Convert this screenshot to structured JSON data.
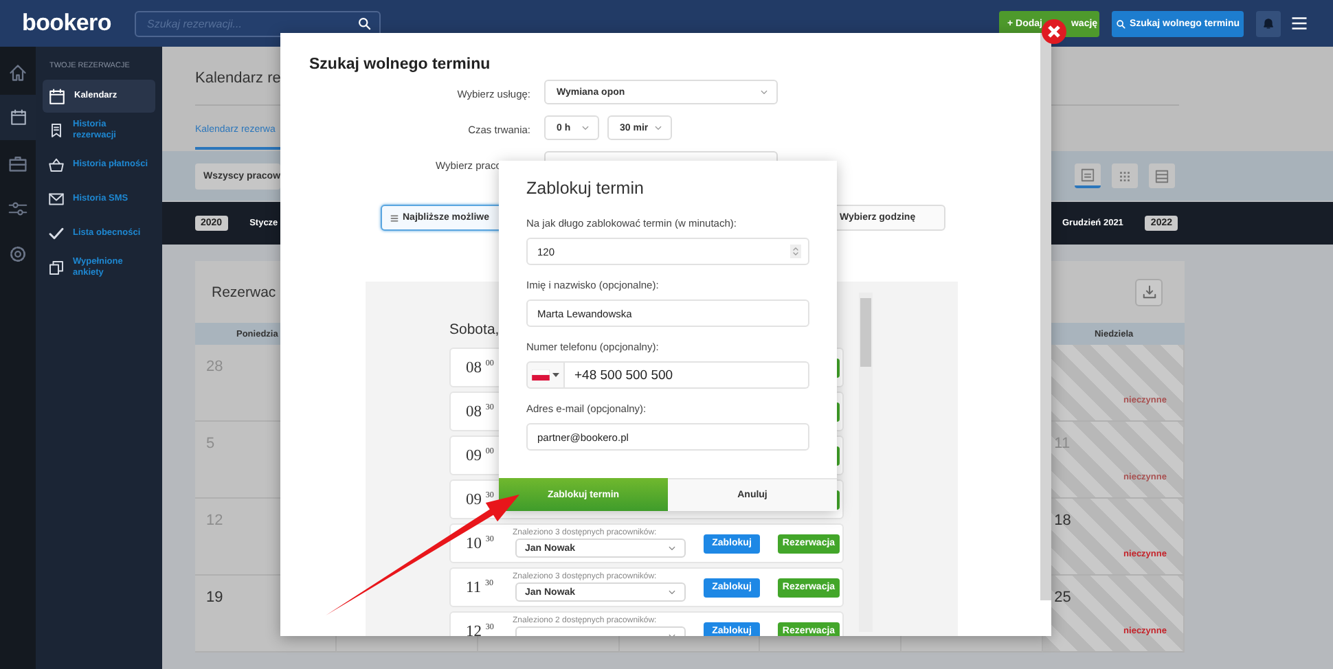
{
  "topbar": {
    "logo": "bookero",
    "search": {
      "placeholder": "Szukaj rezerwacji..."
    },
    "buttons": [
      {
        "label_parts": [
          "+ Dodaj",
          "wację"
        ],
        "kind": "add"
      },
      {
        "label": "Szukaj wolnego terminu",
        "kind": "search"
      }
    ]
  },
  "rail": [
    {
      "selected": false
    },
    {
      "selected": true
    },
    {
      "selected": false
    },
    {
      "selected": false
    },
    {
      "selected": false
    }
  ],
  "sidebar": {
    "heading": "TWOJE REZERWACJE",
    "items": [
      {
        "label": "Kalendarz",
        "selected": true
      },
      {
        "label": "Historia rezerwacji",
        "selected": false
      },
      {
        "label": "Historia płatności",
        "selected": false
      },
      {
        "label": "Historia SMS",
        "selected": false
      },
      {
        "label": "Lista obecności",
        "selected": false
      },
      {
        "label": "Wypełnione ankiety",
        "selected": false
      }
    ]
  },
  "main": {
    "title": "Kalendarz re",
    "tab": "Kalendarz rezerwa",
    "filter": "Wszyscy pracow",
    "views": [
      {
        "selected": true
      },
      {
        "selected": false
      },
      {
        "selected": false
      }
    ],
    "months": [
      {
        "label": "2020",
        "kind": "year"
      },
      {
        "label": "Stycze",
        "kind": "month"
      },
      {
        "label": "Grudzień 2021",
        "kind": "month"
      },
      {
        "label": "2022",
        "kind": "year"
      }
    ],
    "calendar": {
      "title": "Rezerwac",
      "columns": [
        "Poniedzia",
        "Niedziela"
      ],
      "rows": [
        {
          "monday": {
            "day": "28",
            "past": true
          },
          "sunday": {
            "note": "nieczynne",
            "past": true
          }
        },
        {
          "monday": {
            "day": "5",
            "past": true
          },
          "sunday": {
            "day": "11",
            "note": "nieczynne",
            "past": true
          }
        },
        {
          "monday": {
            "day": "12",
            "past": true
          },
          "sunday": {
            "day": "18",
            "note": "nieczynne",
            "past": false
          }
        },
        {
          "monday": {
            "day": "19",
            "past": false
          },
          "sunday": {
            "day": "25",
            "note": "nieczynne",
            "past": false
          }
        }
      ]
    }
  },
  "modal": {
    "title": "Szukaj wolnego terminu",
    "fields": [
      {
        "label": "Wybierz usługę:",
        "kind": "select",
        "value": "Wymiana opon"
      },
      {
        "label": "Czas trwania:",
        "kind": "duration",
        "values": [
          "0 h",
          "30 mir"
        ]
      },
      {
        "label": "Wybierz praco",
        "kind": "select",
        "cut": true
      }
    ],
    "modes": [
      {
        "label": "Najbliższe możliwe",
        "selected": true
      },
      {
        "label": "Wybierz godzinę",
        "selected": false
      }
    ],
    "day_heading": "Sobota,",
    "slots": [
      {
        "time": "08 $^{00}$"
      },
      {
        "time": "08 $^{30}$"
      },
      {
        "time": "09 $^{00}$"
      },
      {
        "time": "09 $^{30}$"
      },
      {
        "time": "10 $^{30}$",
        "found": "Znaleziono 3 dostępnych pracowników:",
        "employee": "Jan Nowak",
        "block": "Zablokuj",
        "book": "Rezerwacja"
      },
      {
        "time": "11 $^{30}$",
        "found": "Znaleziono 3 dostępnych pracowników:",
        "employee": "Jan Nowak",
        "block": "Zablokuj",
        "book": "Rezerwacja"
      },
      {
        "time": "12 $^{30}$",
        "found": "Znaleziono 2 dostępnych pracowników:",
        "block": "Zablokuj",
        "book": "Rezerwacja"
      }
    ]
  },
  "dialog": {
    "title": "Zablokuj termin",
    "fields": [
      {
        "label": "Na jak długo zablokować termin (w minutach):",
        "kind": "number",
        "value": "120"
      },
      {
        "label": "Imię i nazwisko (opcjonalne):",
        "kind": "text",
        "value": "Marta Lewandowska"
      },
      {
        "label": "Numer telefonu (opcjonalny):",
        "kind": "phone",
        "value": "+48 500 500 500"
      },
      {
        "label": "Adres e-mail (opcjonalny):",
        "kind": "text",
        "value": "partner@bookero.pl"
      }
    ],
    "buttons": [
      {
        "label": "Zablokuj termin",
        "kind": "primary"
      },
      {
        "label": "Anuluj",
        "kind": "secondary"
      }
    ]
  }
}
